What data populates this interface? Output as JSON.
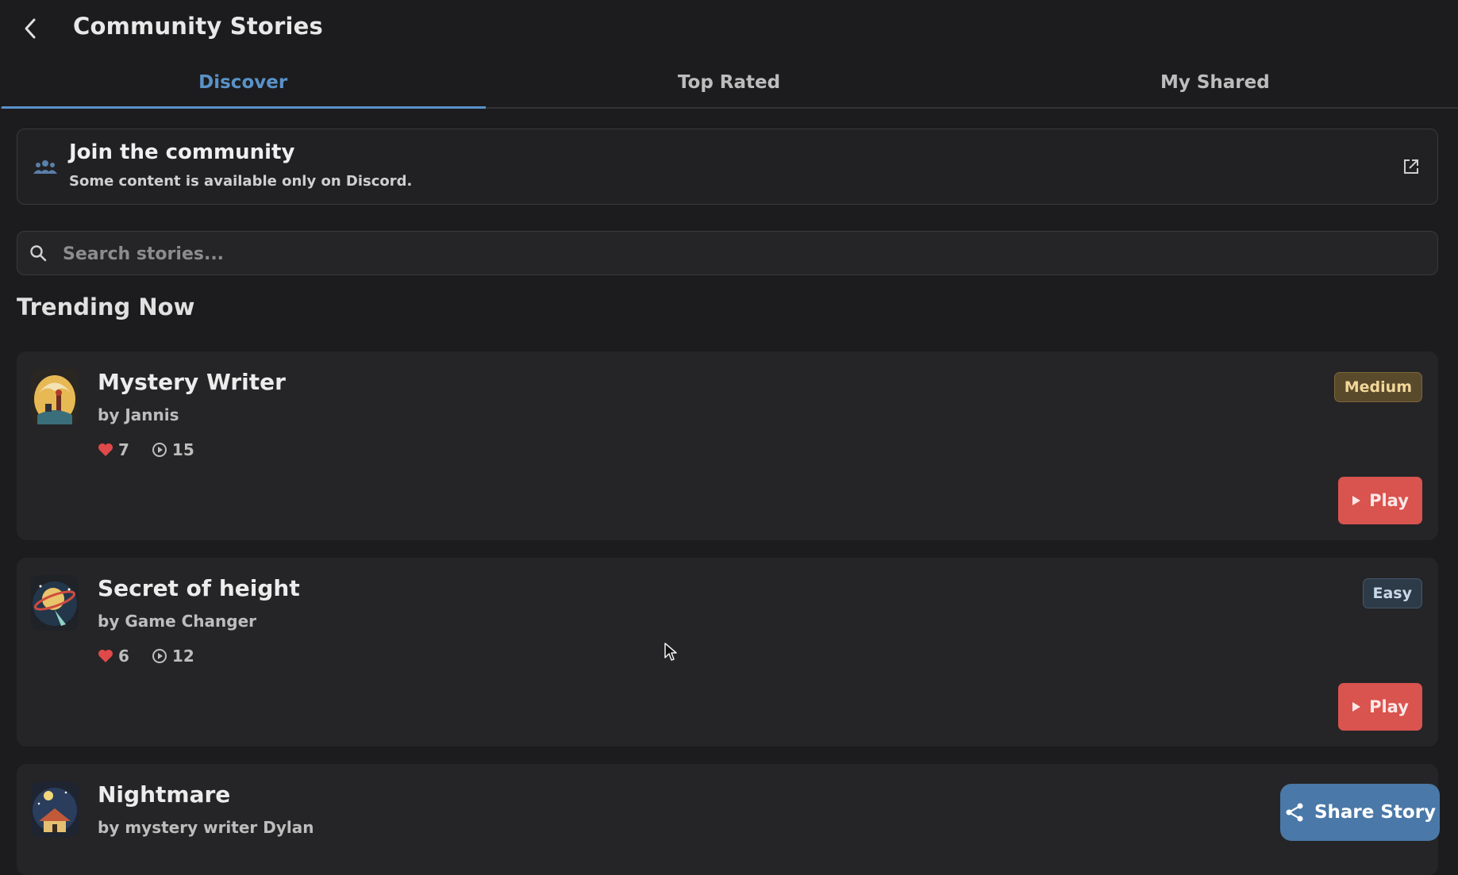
{
  "app": {
    "title": "Community Stories"
  },
  "tabs": [
    {
      "label": "Discover",
      "active": true
    },
    {
      "label": "Top Rated",
      "active": false
    },
    {
      "label": "My Shared",
      "active": false
    }
  ],
  "banner": {
    "title": "Join the community",
    "subtitle": "Some content is available only on Discord.",
    "icon": "people-icon",
    "action_icon": "external-link-icon"
  },
  "search": {
    "placeholder": "Search stories...",
    "value": ""
  },
  "section": {
    "title": "Trending Now"
  },
  "stories": [
    {
      "title": "Mystery Writer",
      "author": "by Jannis",
      "likes": "7",
      "plays": "15",
      "difficulty": "Medium",
      "play_label": "Play"
    },
    {
      "title": "Secret of height",
      "author": "by Game Changer",
      "likes": "6",
      "plays": "12",
      "difficulty": "Easy",
      "play_label": "Play"
    },
    {
      "title": "Nightmare",
      "author": "by mystery writer Dylan"
    }
  ],
  "fab": {
    "label": "Share Story",
    "icon": "share-icon"
  },
  "colors": {
    "background": "#1c1c1e",
    "card": "#252527",
    "accent_blue": "#5a92c8",
    "play_red": "#d9534f",
    "like_red": "#e0494a",
    "fab_blue": "#4a78a8"
  }
}
